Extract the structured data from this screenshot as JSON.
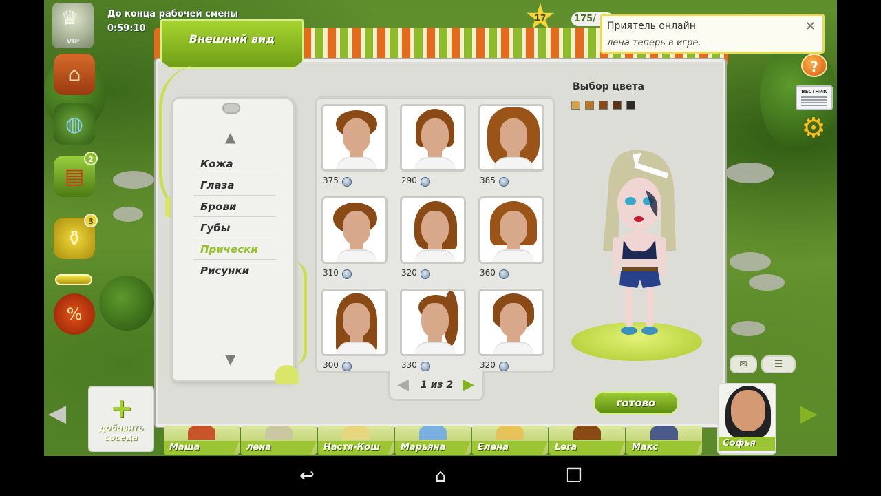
{
  "hud": {
    "vip_label": "VIP",
    "shift_label": "До конца рабочей смены",
    "shift_timer": "0:59:10",
    "level": "17",
    "energy": "175/"
  },
  "notification": {
    "title": "Приятель онлайн",
    "text": "лена теперь в игре.",
    "close": "×"
  },
  "window": {
    "title": "Внешний вид",
    "categories": [
      "Кожа",
      "Глаза",
      "Брови",
      "Губы",
      "Прически",
      "Рисунки"
    ],
    "active_category": "Прически",
    "hairstyles": [
      {
        "price": "375"
      },
      {
        "price": "290"
      },
      {
        "price": "385"
      },
      {
        "price": "310"
      },
      {
        "price": "320"
      },
      {
        "price": "360"
      },
      {
        "price": "300"
      },
      {
        "price": "330"
      },
      {
        "price": "320"
      }
    ],
    "pager": "1 из 2",
    "color_label": "Выбор цвета",
    "colors": [
      "#d8a24a",
      "#b77826",
      "#8a4a16",
      "#5e3412",
      "#2f2a26"
    ],
    "ready_button": "готово"
  },
  "sidebar": {
    "mission_badge": "2",
    "watering_badge": "3",
    "news_label": "ВЕСТНИК"
  },
  "neighbors": {
    "add_label": "добавить соседа",
    "list": [
      "Маша",
      "лена",
      "Настя-Кош",
      "Марьяна",
      "Елена",
      "Lera",
      "Макс"
    ],
    "featured": "Софья"
  },
  "android": {
    "back": "↩",
    "home": "⌂",
    "recent": "❐"
  }
}
